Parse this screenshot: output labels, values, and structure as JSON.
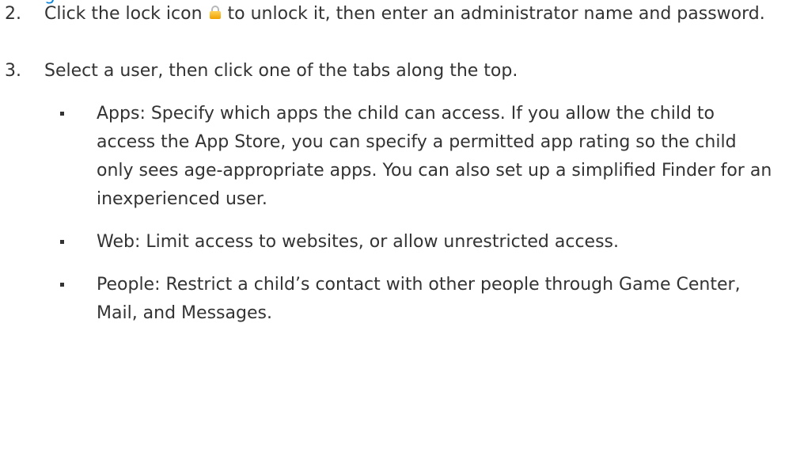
{
  "header": {
    "partial_link_text": "g"
  },
  "steps": [
    {
      "number": "2.",
      "text_before_icon": "Click the lock icon",
      "icon": "lock-icon",
      "text_after_icon": "to unlock it, then enter an administrator name and password."
    },
    {
      "number": "3.",
      "text": "Select a user, then click one of the tabs along the top.",
      "bullets": [
        "Apps: Specify which apps the child can access. If you allow the child to access the App Store, you can specify a permitted app rating so the child only sees age-appropriate apps. You can also set up a simplified Finder for an inexperienced user.",
        "Web: Limit access to websites, or allow unrestricted access.",
        "People: Restrict a child’s contact with other people through Game Center, Mail, and Messages."
      ]
    }
  ],
  "colors": {
    "text": "#333333",
    "link": "#0a84d8",
    "lock_body": "#f0a000",
    "lock_shackle": "#b8b8b8"
  }
}
